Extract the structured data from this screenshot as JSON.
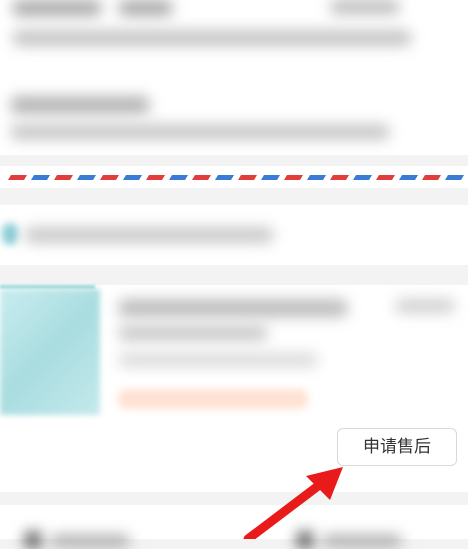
{
  "order": {
    "after_sale_button_label": "申请售后"
  },
  "colors": {
    "airmail_red": "#e23d3d",
    "airmail_blue": "#3a7bd5",
    "annotation_arrow": "#e81a1a",
    "product_thumb": "#b6e2e5",
    "tag_orange": "#ffe2d3"
  },
  "icons": {
    "annotation": "arrow-up-right-icon"
  }
}
